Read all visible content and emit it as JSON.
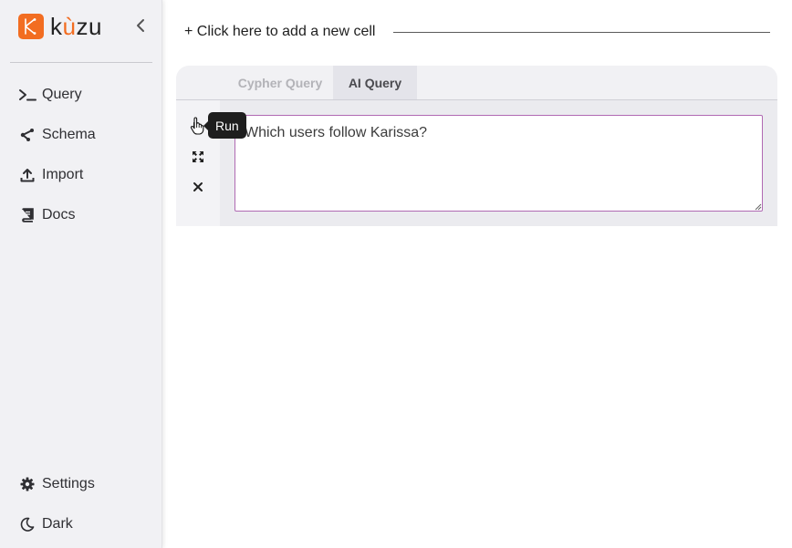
{
  "brand": {
    "name_prefix": "k",
    "name_accent": "ù",
    "name_suffix": "zu",
    "accent_color": "#f26d21"
  },
  "sidebar": {
    "items": [
      {
        "label": "Query",
        "icon": "terminal-icon"
      },
      {
        "label": "Schema",
        "icon": "share-icon"
      },
      {
        "label": "Import",
        "icon": "upload-icon"
      },
      {
        "label": "Docs",
        "icon": "book-icon"
      }
    ],
    "bottom_items": [
      {
        "label": "Settings",
        "icon": "gear-icon"
      },
      {
        "label": "Dark",
        "icon": "moon-icon"
      }
    ]
  },
  "main": {
    "add_cell_label": "+ Click here to add a new cell",
    "cell": {
      "tabs": [
        {
          "label": "Cypher Query",
          "active": false
        },
        {
          "label": "AI Query",
          "active": true
        }
      ],
      "query_text": "Which users follow Karissa?",
      "tools": [
        "play-icon",
        "expand-icon",
        "close-icon"
      ],
      "tooltip": "Run"
    }
  },
  "colors": {
    "input_border": "#b06ab3",
    "sidebar_bg": "#f1f1f4"
  }
}
